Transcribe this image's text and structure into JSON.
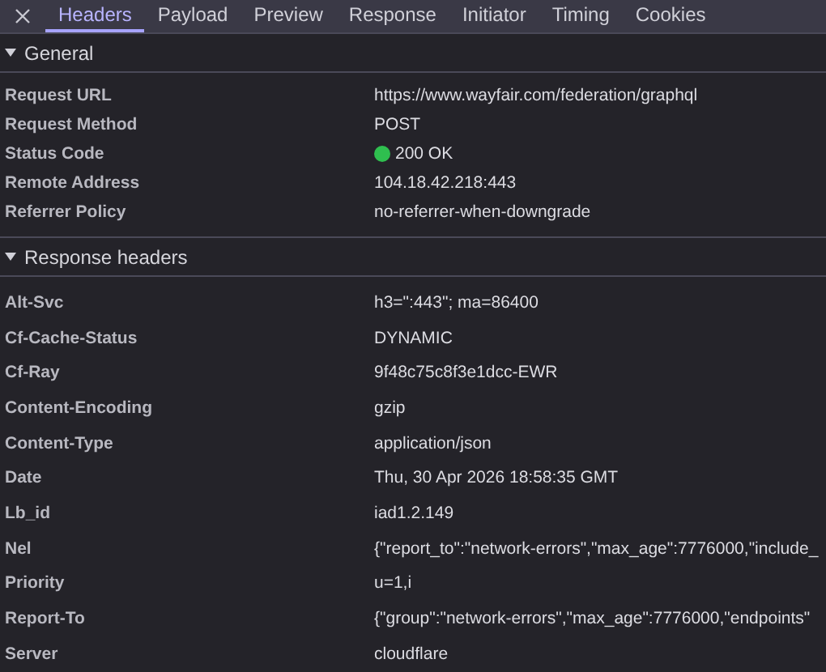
{
  "tabs": [
    {
      "label": "Headers",
      "selected": true
    },
    {
      "label": "Payload",
      "selected": false
    },
    {
      "label": "Preview",
      "selected": false
    },
    {
      "label": "Response",
      "selected": false
    },
    {
      "label": "Initiator",
      "selected": false
    },
    {
      "label": "Timing",
      "selected": false
    },
    {
      "label": "Cookies",
      "selected": false
    }
  ],
  "sections": [
    {
      "title": "General",
      "expanded": true,
      "rows": [
        {
          "name": "Request URL",
          "value": "https://www.wayfair.com/federation/graphql"
        },
        {
          "name": "Request Method",
          "value": "POST"
        },
        {
          "name": "Status Code",
          "value": "200 OK",
          "color": "#2fbf4f"
        },
        {
          "name": "Remote Address",
          "value": "104.18.42.218:443"
        },
        {
          "name": "Referrer Policy",
          "value": "no-referrer-when-downgrade"
        }
      ]
    },
    {
      "title": "Response headers",
      "expanded": true,
      "rows": [
        {
          "name": "Alt-Svc",
          "value": "h3=\":443\"; ma=86400"
        },
        {
          "name": "Cf-Cache-Status",
          "value": "DYNAMIC"
        },
        {
          "name": "Cf-Ray",
          "value": "9f48c75c8f3e1dcc-EWR"
        },
        {
          "name": "Content-Encoding",
          "value": "gzip"
        },
        {
          "name": "Content-Type",
          "value": "application/json"
        },
        {
          "name": "Date",
          "value": "Thu, 30 Apr 2026 18:58:35 GMT"
        },
        {
          "name": "Lb_id",
          "value": "iad1.2.149"
        },
        {
          "name": "Nel",
          "value": "{\"report_to\":\"network-errors\",\"max_age\":7776000,\"include_"
        },
        {
          "name": "Priority",
          "value": "u=1,i"
        },
        {
          "name": "Report-To",
          "value": "{\"group\":\"network-errors\",\"max_age\":7776000,\"endpoints\""
        },
        {
          "name": "Server",
          "value": "cloudflare"
        }
      ]
    }
  ]
}
